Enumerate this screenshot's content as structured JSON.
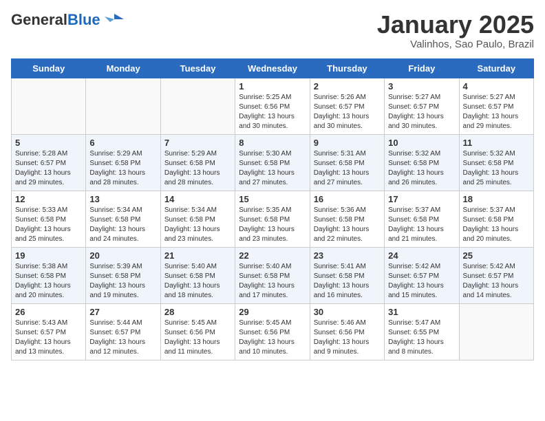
{
  "header": {
    "logo_general": "General",
    "logo_blue": "Blue",
    "month_title": "January 2025",
    "location": "Valinhos, Sao Paulo, Brazil"
  },
  "days_of_week": [
    "Sunday",
    "Monday",
    "Tuesday",
    "Wednesday",
    "Thursday",
    "Friday",
    "Saturday"
  ],
  "weeks": [
    [
      {
        "day": "",
        "info": ""
      },
      {
        "day": "",
        "info": ""
      },
      {
        "day": "",
        "info": ""
      },
      {
        "day": "1",
        "info": "Sunrise: 5:25 AM\nSunset: 6:56 PM\nDaylight: 13 hours\nand 30 minutes."
      },
      {
        "day": "2",
        "info": "Sunrise: 5:26 AM\nSunset: 6:57 PM\nDaylight: 13 hours\nand 30 minutes."
      },
      {
        "day": "3",
        "info": "Sunrise: 5:27 AM\nSunset: 6:57 PM\nDaylight: 13 hours\nand 30 minutes."
      },
      {
        "day": "4",
        "info": "Sunrise: 5:27 AM\nSunset: 6:57 PM\nDaylight: 13 hours\nand 29 minutes."
      }
    ],
    [
      {
        "day": "5",
        "info": "Sunrise: 5:28 AM\nSunset: 6:57 PM\nDaylight: 13 hours\nand 29 minutes."
      },
      {
        "day": "6",
        "info": "Sunrise: 5:29 AM\nSunset: 6:58 PM\nDaylight: 13 hours\nand 28 minutes."
      },
      {
        "day": "7",
        "info": "Sunrise: 5:29 AM\nSunset: 6:58 PM\nDaylight: 13 hours\nand 28 minutes."
      },
      {
        "day": "8",
        "info": "Sunrise: 5:30 AM\nSunset: 6:58 PM\nDaylight: 13 hours\nand 27 minutes."
      },
      {
        "day": "9",
        "info": "Sunrise: 5:31 AM\nSunset: 6:58 PM\nDaylight: 13 hours\nand 27 minutes."
      },
      {
        "day": "10",
        "info": "Sunrise: 5:32 AM\nSunset: 6:58 PM\nDaylight: 13 hours\nand 26 minutes."
      },
      {
        "day": "11",
        "info": "Sunrise: 5:32 AM\nSunset: 6:58 PM\nDaylight: 13 hours\nand 25 minutes."
      }
    ],
    [
      {
        "day": "12",
        "info": "Sunrise: 5:33 AM\nSunset: 6:58 PM\nDaylight: 13 hours\nand 25 minutes."
      },
      {
        "day": "13",
        "info": "Sunrise: 5:34 AM\nSunset: 6:58 PM\nDaylight: 13 hours\nand 24 minutes."
      },
      {
        "day": "14",
        "info": "Sunrise: 5:34 AM\nSunset: 6:58 PM\nDaylight: 13 hours\nand 23 minutes."
      },
      {
        "day": "15",
        "info": "Sunrise: 5:35 AM\nSunset: 6:58 PM\nDaylight: 13 hours\nand 23 minutes."
      },
      {
        "day": "16",
        "info": "Sunrise: 5:36 AM\nSunset: 6:58 PM\nDaylight: 13 hours\nand 22 minutes."
      },
      {
        "day": "17",
        "info": "Sunrise: 5:37 AM\nSunset: 6:58 PM\nDaylight: 13 hours\nand 21 minutes."
      },
      {
        "day": "18",
        "info": "Sunrise: 5:37 AM\nSunset: 6:58 PM\nDaylight: 13 hours\nand 20 minutes."
      }
    ],
    [
      {
        "day": "19",
        "info": "Sunrise: 5:38 AM\nSunset: 6:58 PM\nDaylight: 13 hours\nand 20 minutes."
      },
      {
        "day": "20",
        "info": "Sunrise: 5:39 AM\nSunset: 6:58 PM\nDaylight: 13 hours\nand 19 minutes."
      },
      {
        "day": "21",
        "info": "Sunrise: 5:40 AM\nSunset: 6:58 PM\nDaylight: 13 hours\nand 18 minutes."
      },
      {
        "day": "22",
        "info": "Sunrise: 5:40 AM\nSunset: 6:58 PM\nDaylight: 13 hours\nand 17 minutes."
      },
      {
        "day": "23",
        "info": "Sunrise: 5:41 AM\nSunset: 6:58 PM\nDaylight: 13 hours\nand 16 minutes."
      },
      {
        "day": "24",
        "info": "Sunrise: 5:42 AM\nSunset: 6:57 PM\nDaylight: 13 hours\nand 15 minutes."
      },
      {
        "day": "25",
        "info": "Sunrise: 5:42 AM\nSunset: 6:57 PM\nDaylight: 13 hours\nand 14 minutes."
      }
    ],
    [
      {
        "day": "26",
        "info": "Sunrise: 5:43 AM\nSunset: 6:57 PM\nDaylight: 13 hours\nand 13 minutes."
      },
      {
        "day": "27",
        "info": "Sunrise: 5:44 AM\nSunset: 6:57 PM\nDaylight: 13 hours\nand 12 minutes."
      },
      {
        "day": "28",
        "info": "Sunrise: 5:45 AM\nSunset: 6:56 PM\nDaylight: 13 hours\nand 11 minutes."
      },
      {
        "day": "29",
        "info": "Sunrise: 5:45 AM\nSunset: 6:56 PM\nDaylight: 13 hours\nand 10 minutes."
      },
      {
        "day": "30",
        "info": "Sunrise: 5:46 AM\nSunset: 6:56 PM\nDaylight: 13 hours\nand 9 minutes."
      },
      {
        "day": "31",
        "info": "Sunrise: 5:47 AM\nSunset: 6:55 PM\nDaylight: 13 hours\nand 8 minutes."
      },
      {
        "day": "",
        "info": ""
      }
    ]
  ]
}
